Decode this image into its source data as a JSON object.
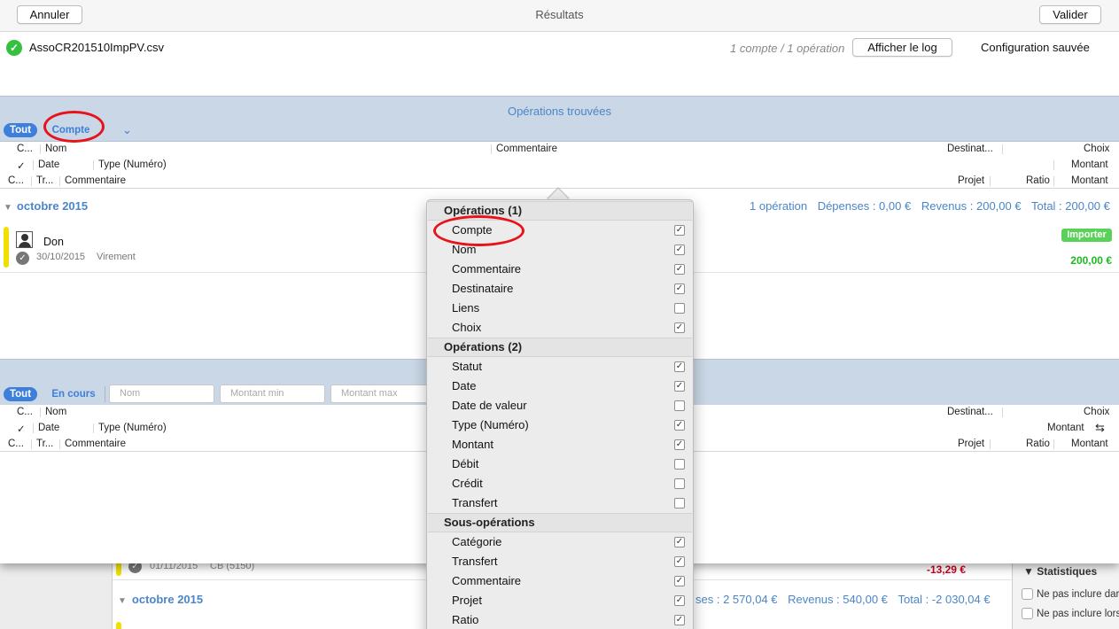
{
  "toolbar": {
    "cancel": "Annuler",
    "title": "Résultats",
    "validate": "Valider"
  },
  "file": {
    "name": "AssoCR201510ImpPV.csv",
    "count": "1 compte / 1 opération",
    "log_button": "Afficher le log",
    "config": "Configuration sauvée"
  },
  "section1": {
    "title": "Opérations trouvées",
    "filter_all": "Tout",
    "filter_account": "Compte",
    "chevron": "⌄",
    "headers": {
      "r1": [
        "C...",
        "Nom",
        "Commentaire",
        "Destinat...",
        "Choix"
      ],
      "r2": [
        "✓",
        "Date",
        "Type (Numéro)",
        "Montant"
      ],
      "r3": [
        "C...",
        "Tr...",
        "Commentaire",
        "Projet",
        "Ratio",
        "Montant"
      ]
    },
    "month": "octobre 2015",
    "summary": {
      "count": "1 opération",
      "expenses": "Dépenses : 0,00 €",
      "income": "Revenus : 200,00 €",
      "total": "Total : 200,00 €"
    },
    "operation": {
      "name": "Don",
      "date": "30/10/2015",
      "type": "Virement",
      "import_label": "Importer",
      "amount": "200,00 €"
    }
  },
  "section2": {
    "filter_all": "Tout",
    "filter_in_progress": "En cours",
    "placeholders": {
      "name": "Nom",
      "min": "Montant min",
      "max": "Montant max"
    },
    "headers": {
      "r1": [
        "C...",
        "Nom",
        "Destinat...",
        "Choix"
      ],
      "r2": [
        "✓",
        "Date",
        "Type (Numéro)",
        "Montant"
      ],
      "r3": [
        "C...",
        "Tr...",
        "Commentaire",
        "Projet",
        "Ratio",
        "Montant"
      ]
    }
  },
  "background": {
    "row": {
      "date": "01/11/2015",
      "type": "CB (5150)",
      "amount": "-13,29 €"
    },
    "month": "octobre 2015",
    "summary": {
      "expenses": "ses : 2 570,04 €",
      "income": "Revenus : 540,00 €",
      "total": "Total : -2 030,04 €"
    },
    "stats": {
      "title": "Statistiques",
      "opt1": "Ne pas inclure dar",
      "opt2": "Ne pas inclure lors"
    }
  },
  "popover": {
    "groups": {
      "g1": {
        "title": "Opérations (1)",
        "items": [
          {
            "label": "Compte",
            "checked": true
          },
          {
            "label": "Nom",
            "checked": true
          },
          {
            "label": "Commentaire",
            "checked": true
          },
          {
            "label": "Destinataire",
            "checked": true
          },
          {
            "label": "Liens",
            "checked": false
          },
          {
            "label": "Choix",
            "checked": true
          }
        ]
      },
      "g2": {
        "title": "Opérations (2)",
        "items": [
          {
            "label": "Statut",
            "checked": true
          },
          {
            "label": "Date",
            "checked": true
          },
          {
            "label": "Date de valeur",
            "checked": false
          },
          {
            "label": "Type (Numéro)",
            "checked": true
          },
          {
            "label": "Montant",
            "checked": true
          },
          {
            "label": "Débit",
            "checked": false
          },
          {
            "label": "Crédit",
            "checked": false
          },
          {
            "label": "Transfert",
            "checked": false
          }
        ]
      },
      "g3": {
        "title": "Sous-opérations",
        "items": [
          {
            "label": "Catégorie",
            "checked": true
          },
          {
            "label": "Transfert",
            "checked": true
          },
          {
            "label": "Commentaire",
            "checked": true
          },
          {
            "label": "Projet",
            "checked": true
          },
          {
            "label": "Ratio",
            "checked": true
          }
        ]
      }
    }
  },
  "colors": {
    "accent": "#3e7fd9",
    "section_bg": "#c9d7e6",
    "positive": "#1fb81f",
    "negative": "#d0021b",
    "highlight": "#e8121a"
  }
}
